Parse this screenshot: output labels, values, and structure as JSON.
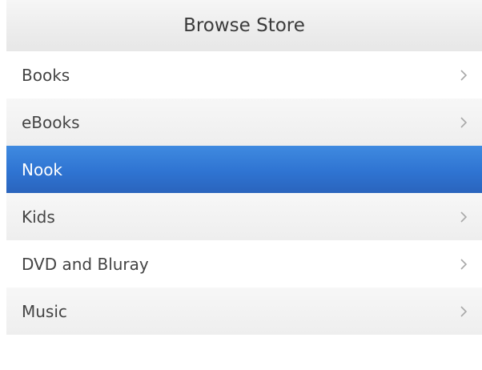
{
  "header": {
    "title": "Browse Store"
  },
  "menu": {
    "items": [
      {
        "label": "Books",
        "icon": "chevron-right-icon",
        "selected": false
      },
      {
        "label": "eBooks",
        "icon": "chevron-right-icon",
        "selected": false
      },
      {
        "label": "Nook",
        "icon": "",
        "selected": true
      },
      {
        "label": "Kids",
        "icon": "chevron-right-icon",
        "selected": false
      },
      {
        "label": "DVD and Bluray",
        "icon": "chevron-right-icon",
        "selected": false
      },
      {
        "label": "Music",
        "icon": "chevron-right-icon",
        "selected": false
      }
    ]
  },
  "colors": {
    "selected_background": "#2f74d2",
    "selected_text": "#ffffff",
    "text": "#444444",
    "chevron": "#a8a8a8"
  }
}
